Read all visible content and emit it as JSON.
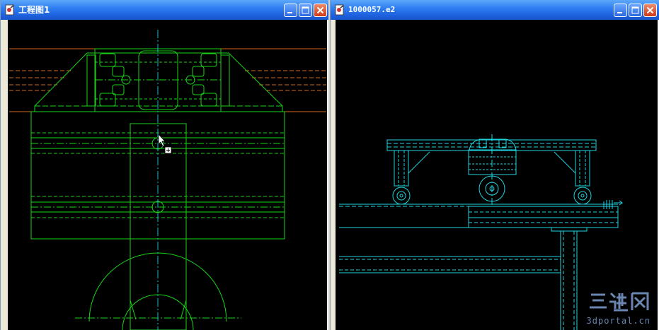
{
  "windows": [
    {
      "title": "工程图1",
      "controls": [
        "minimize",
        "maximize",
        "close"
      ]
    },
    {
      "title": "1000057.e2",
      "controls": [
        "minimize",
        "maximize",
        "close"
      ]
    }
  ],
  "colors": {
    "drawing_bg": "#000000",
    "green_lines": "#19d219",
    "orange_lines": "#d2691e",
    "cyan_lines": "#21d4e1",
    "titlebar": "#2f7ff3"
  },
  "watermark": {
    "logo": "三维网",
    "url": "3dportal.cn"
  }
}
